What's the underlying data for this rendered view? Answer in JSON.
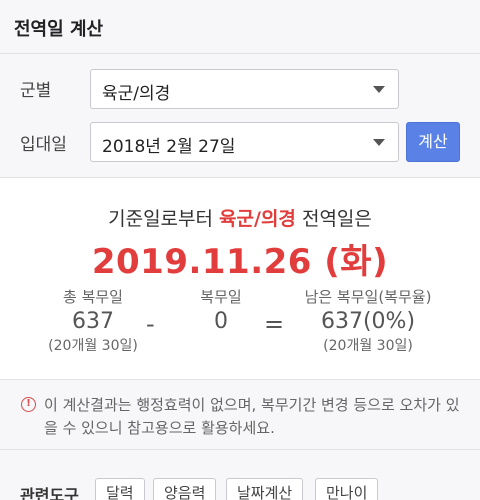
{
  "header": {
    "title": "전역일 계산"
  },
  "form": {
    "branch_label": "군별",
    "branch_value": "육군/의경",
    "enlist_label": "입대일",
    "enlist_value": "2018년 2월 27일",
    "calc_button": "계산"
  },
  "result": {
    "headline_prefix": "기준일로부터",
    "headline_branch": "육군/의경",
    "headline_suffix": "전역일은",
    "discharge_date": "2019.11.26 (화)",
    "total": {
      "label": "총 복무일",
      "value": "637",
      "sub": "(20개월 30일)"
    },
    "minus": "-",
    "served": {
      "label": "복무일",
      "value": "0"
    },
    "equals": "=",
    "remaining": {
      "label": "남은 복무일(복무율)",
      "value": "637(0%)",
      "sub": "(20개월 30일)"
    }
  },
  "notice": {
    "icon": "exclamation-circle-icon",
    "text": "이 계산결과는 행정효력이 없으며, 복무기간 변경 등으로 오차가 있을 수 있으니 참고용으로 활용하세요."
  },
  "related": {
    "label": "관련도구",
    "tools": [
      "달력",
      "양음력",
      "날짜계산",
      "만나이"
    ]
  },
  "colors": {
    "accent_red": "#e23d3d",
    "button_blue": "#5a82e6"
  }
}
